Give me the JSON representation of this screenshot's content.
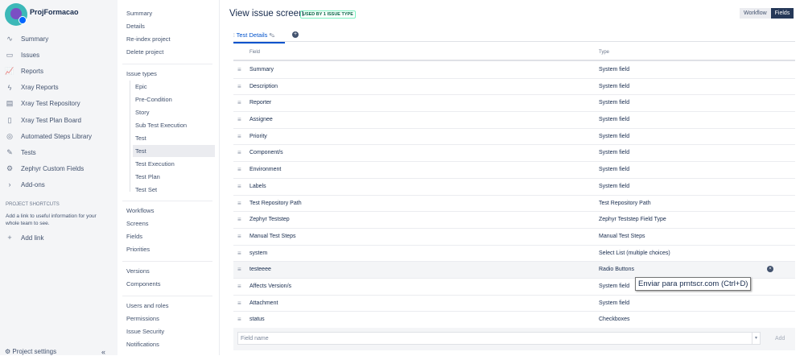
{
  "project": {
    "name": "ProjFormacao"
  },
  "sidebar": {
    "items": [
      {
        "label": "Summary",
        "icon": "pulse-icon",
        "glyph": "∿"
      },
      {
        "label": "Issues",
        "icon": "issues-icon",
        "glyph": "▭"
      },
      {
        "label": "Reports",
        "icon": "reports-icon",
        "glyph": "📈"
      },
      {
        "label": "Xray Reports",
        "icon": "lightning-icon",
        "glyph": "ϟ"
      },
      {
        "label": "Xray Test Repository",
        "icon": "repository-icon",
        "glyph": "▤"
      },
      {
        "label": "Xray Test Plan Board",
        "icon": "board-icon",
        "glyph": "▯"
      },
      {
        "label": "Automated Steps Library",
        "icon": "library-icon",
        "glyph": "◎"
      },
      {
        "label": "Tests",
        "icon": "tests-icon",
        "glyph": "✎"
      },
      {
        "label": "Zephyr Custom Fields",
        "icon": "zephyr-icon",
        "glyph": "⚙"
      },
      {
        "label": "Add-ons",
        "icon": "chevron-right-icon",
        "glyph": "›"
      }
    ],
    "shortcuts_heading": "PROJECT SHORTCUTS",
    "shortcuts_text": "Add a link to useful information for your whole team to see.",
    "add_link": "Add link",
    "project_settings": "Project settings"
  },
  "settings_nav": {
    "group1": [
      "Summary",
      "Details",
      "Re-index project",
      "Delete project"
    ],
    "issue_types_heading": "Issue types",
    "issue_types": [
      "Epic",
      "Pre-Condition",
      "Story",
      "Sub Test Execution",
      "Test",
      "Test",
      "Test Execution",
      "Test Plan",
      "Test Set"
    ],
    "group2": [
      "Workflows",
      "Screens",
      "Fields",
      "Priorities"
    ],
    "group3": [
      "Versions",
      "Components"
    ],
    "group4": [
      "Users and roles",
      "Permissions",
      "Issue Security",
      "Notifications"
    ]
  },
  "main": {
    "title": "View issue screen",
    "badge": "USED BY 1 ISSUE TYPE",
    "workflow_btn": "Workflow",
    "fields_btn": "Fields",
    "tab": "Test Details",
    "col_field": "Field",
    "col_type": "Type",
    "rows": [
      {
        "field": "Summary",
        "type": "System field"
      },
      {
        "field": "Description",
        "type": "System field"
      },
      {
        "field": "Reporter",
        "type": "System field"
      },
      {
        "field": "Assignee",
        "type": "System field"
      },
      {
        "field": "Priority",
        "type": "System field"
      },
      {
        "field": "Component/s",
        "type": "System field"
      },
      {
        "field": "Environment",
        "type": "System field"
      },
      {
        "field": "Labels",
        "type": "System field"
      },
      {
        "field": "Test Repository Path",
        "type": "Test Repository Path"
      },
      {
        "field": "Zephyr Teststep",
        "type": "Zephyr Teststep Field Type"
      },
      {
        "field": "Manual Test Steps",
        "type": "Manual Test Steps"
      },
      {
        "field": "system",
        "type": "Select List (multiple choices)"
      },
      {
        "field": "testeeee",
        "type": "Radio Buttons"
      },
      {
        "field": "Affects Version/s",
        "type": "System field"
      },
      {
        "field": "Attachment",
        "type": "System field"
      },
      {
        "field": "status",
        "type": "Checkboxes"
      }
    ],
    "field_placeholder": "Field name",
    "add_btn": "Add"
  },
  "tooltip": "Enviar para prntscr.com (Ctrl+D)"
}
